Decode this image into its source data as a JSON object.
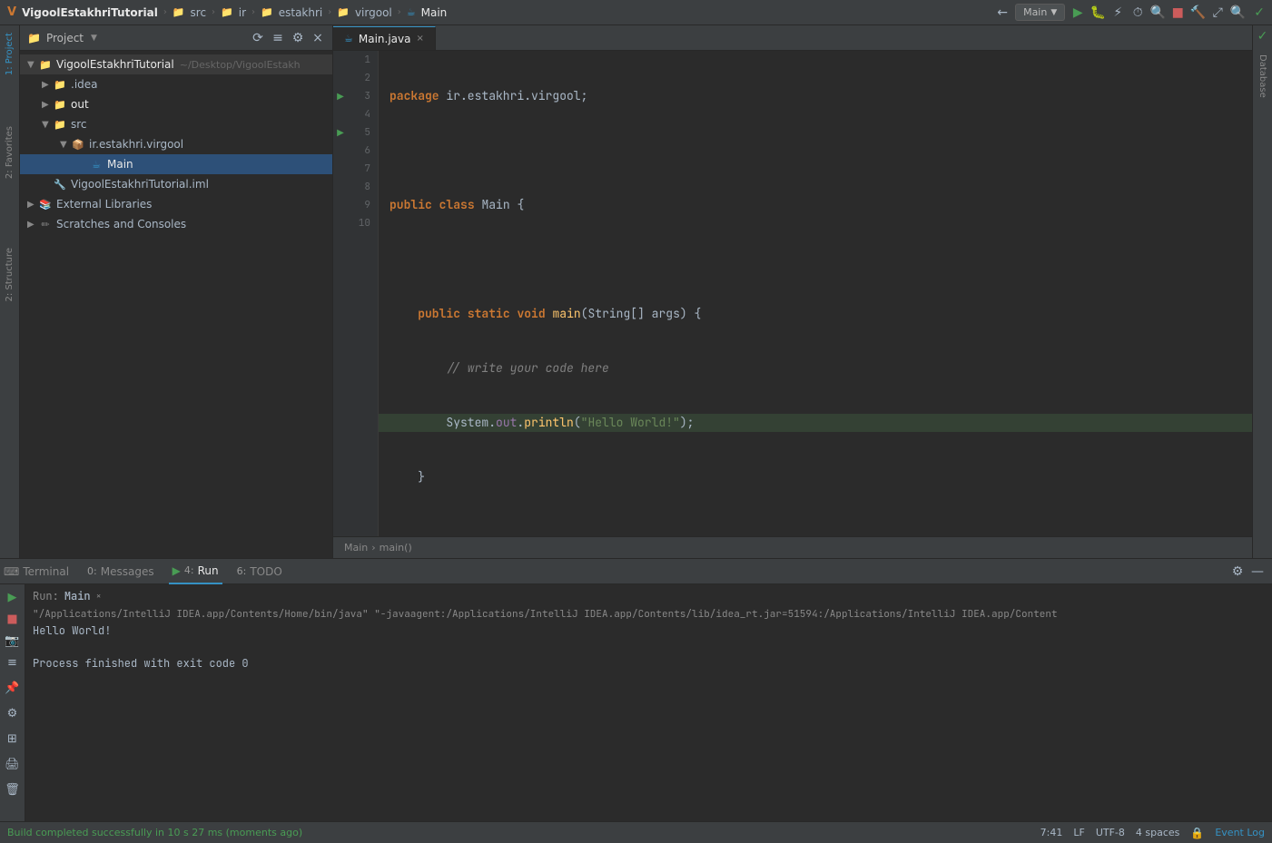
{
  "titleBar": {
    "appName": "VigoolEstakhriTutorial",
    "breadcrumbs": [
      "src",
      "ir",
      "estakhri",
      "virgool",
      "Main"
    ],
    "runConfig": "Main",
    "checkmark": "✓"
  },
  "toolbar": {
    "projectLabel": "Project",
    "icons": [
      "⚙",
      "≡",
      "—",
      "+"
    ]
  },
  "fileTree": {
    "root": {
      "name": "VigoolEstakhriTutorial",
      "path": "~/Desktop/VigoolEstakh",
      "children": [
        {
          "name": ".idea",
          "type": "folder",
          "indent": 1
        },
        {
          "name": "out",
          "type": "folder-yellow",
          "indent": 1
        },
        {
          "name": "src",
          "type": "folder",
          "indent": 1,
          "expanded": true,
          "children": [
            {
              "name": "ir.estakhri.virgool",
              "type": "package",
              "indent": 2,
              "expanded": true,
              "children": [
                {
                  "name": "Main",
                  "type": "java-class",
                  "indent": 3,
                  "selected": true
                }
              ]
            }
          ]
        },
        {
          "name": "VigoolEstakhriTutorial.iml",
          "type": "iml",
          "indent": 1
        }
      ]
    },
    "external": {
      "name": "External Libraries",
      "indent": 0
    },
    "scratches": {
      "name": "Scratches and Consoles",
      "indent": 0
    }
  },
  "editor": {
    "tab": {
      "name": "Main.java",
      "active": true
    },
    "lines": [
      {
        "num": 1,
        "code": "package ir.estakhri.virgool;",
        "type": "plain",
        "hasRunIcon": false
      },
      {
        "num": 2,
        "code": "",
        "type": "blank",
        "hasRunIcon": false
      },
      {
        "num": 3,
        "code": "public class Main {",
        "type": "class-decl",
        "hasRunIcon": true
      },
      {
        "num": 4,
        "code": "",
        "type": "blank",
        "hasRunIcon": false
      },
      {
        "num": 5,
        "code": "    public static void main(String[] args) {",
        "type": "method-decl",
        "hasRunIcon": true
      },
      {
        "num": 6,
        "code": "        // write your code here",
        "type": "comment",
        "hasRunIcon": false
      },
      {
        "num": 7,
        "code": "        System.out.println(\"Hello World!\");",
        "type": "code",
        "hasRunIcon": false,
        "highlighted": true
      },
      {
        "num": 8,
        "code": "    }",
        "type": "plain",
        "hasRunIcon": false
      },
      {
        "num": 9,
        "code": "",
        "type": "blank",
        "hasRunIcon": false
      },
      {
        "num": 10,
        "code": "}",
        "type": "plain",
        "hasRunIcon": false
      }
    ],
    "breadcrumb": {
      "parts": [
        "Main",
        "main()"
      ]
    }
  },
  "runPanel": {
    "runLabel": "Run:",
    "configName": "Main",
    "cmdLine": "\"/Applications/IntelliJ IDEA.app/Contents/Home/bin/java\" \"-javaagent:/Applications/IntelliJ IDEA.app/Contents/lib/idea_rt.jar=51594:/Applications/IntelliJ IDEA.app/Content",
    "output1": "Hello World!",
    "output2": "",
    "output3": "Process finished with exit code 0"
  },
  "bottomTabs": [
    {
      "icon": "▶",
      "label": "Terminal",
      "num": "",
      "active": false
    },
    {
      "icon": "⬜",
      "label": "Messages",
      "num": "0",
      "active": false
    },
    {
      "icon": "▶",
      "label": "Run",
      "num": "4",
      "active": true
    },
    {
      "icon": "☑",
      "label": "TODO",
      "num": "6",
      "active": false
    }
  ],
  "statusBar": {
    "buildMsg": "Build completed successfully in 10 s 27 ms (moments ago)",
    "position": "7:41",
    "lineEnding": "LF",
    "encoding": "UTF-8",
    "indentation": "4 spaces",
    "eventLog": "Event Log"
  },
  "rightSidebar": {
    "label": "Database"
  },
  "leftSideTabs": [
    {
      "label": "1: Project",
      "active": true
    },
    {
      "label": "2: Favorites"
    },
    {
      "label": "2: Structure"
    }
  ]
}
